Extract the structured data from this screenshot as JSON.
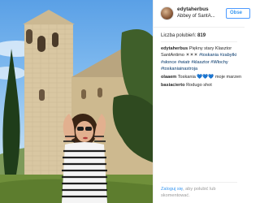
{
  "post": {
    "username": "edytaherbus",
    "location": "Abbey of SantA...",
    "follow_label": "Obse",
    "likes_label": "Liczba polubień:",
    "likes_count": "819"
  },
  "comments": [
    {
      "user": "edytaherbus",
      "text": "Piękny stary Klasztor SantAntimo ☀☀☀",
      "hashtags": [
        "#toskania",
        "#zabytki",
        "#słonce",
        "#wiatr",
        "#klasztor",
        "#Włochy",
        "#toskaniainastroja"
      ]
    },
    {
      "user": "olaaem",
      "text": "Toskania 💙💙💙 moje marzen"
    },
    {
      "user": "basiacierto",
      "text": "Rodugo shot"
    }
  ],
  "footer": {
    "login_link": "Zaloguj się",
    "login_rest": ", aby polubić lub skomentować."
  },
  "colors": {
    "link_blue": "#3897f0",
    "hashtag_blue": "#003569",
    "sky": "#5aa0e6"
  }
}
